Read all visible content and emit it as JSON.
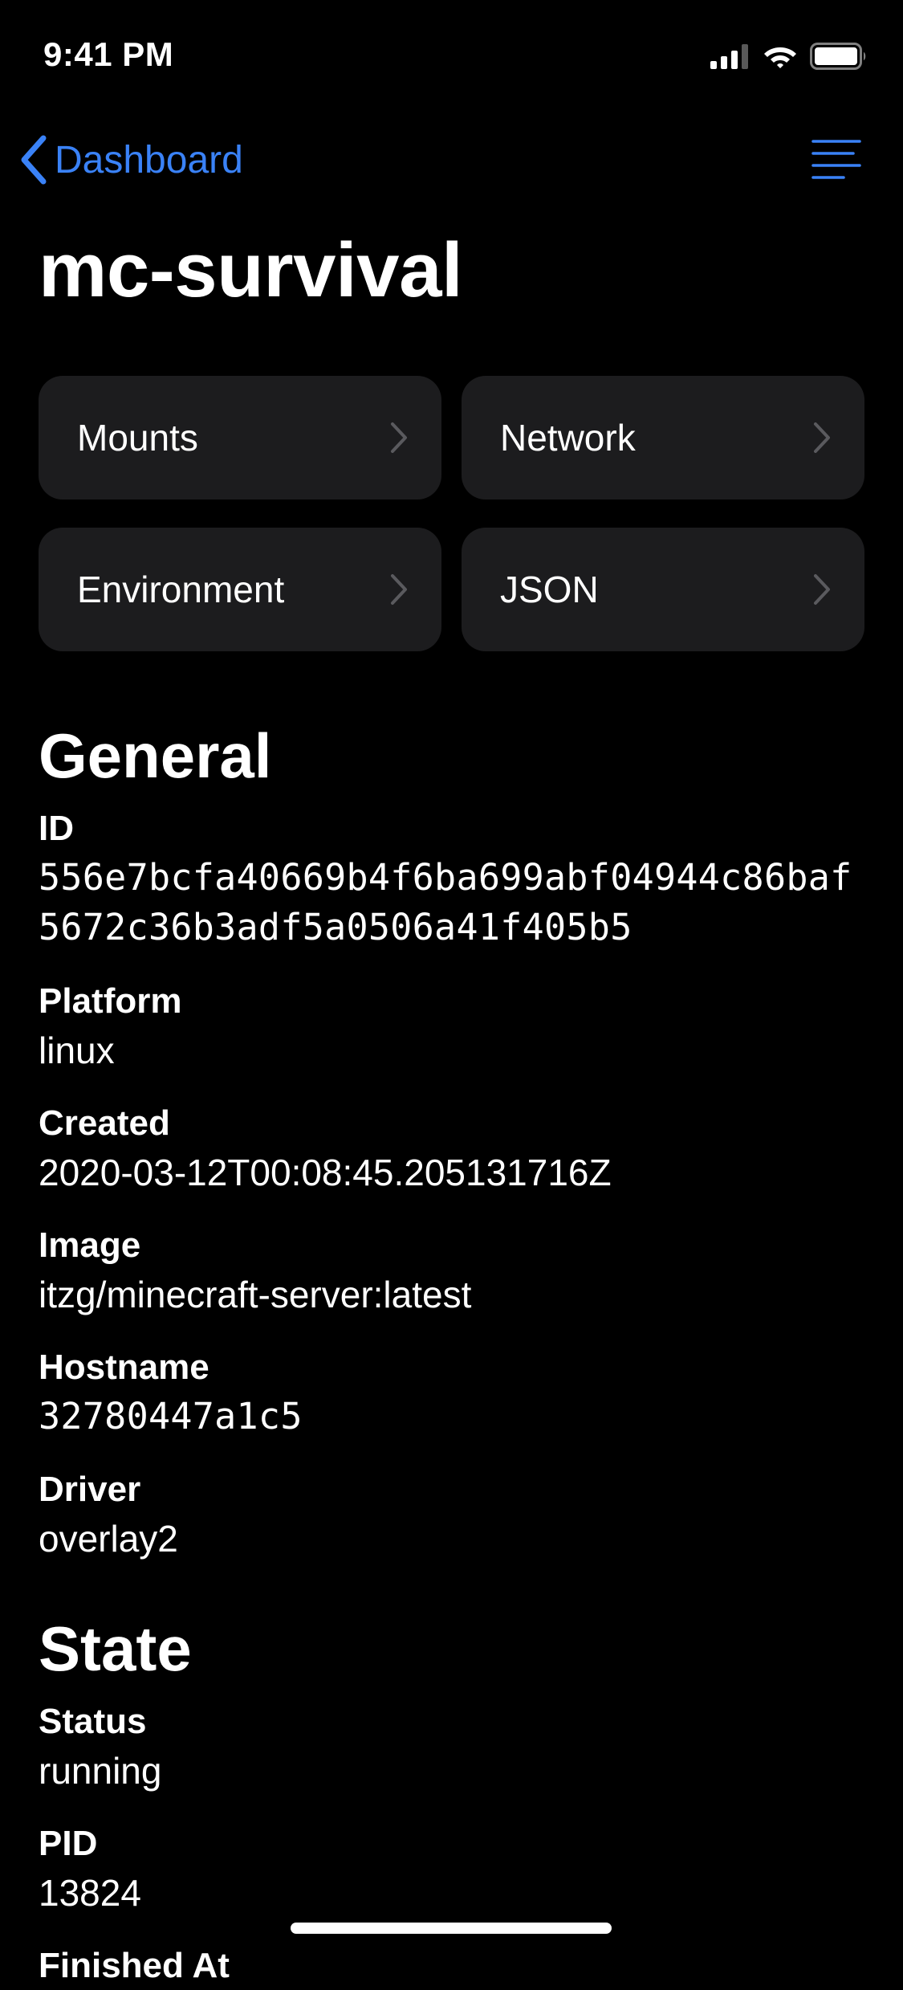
{
  "status_bar": {
    "time": "9:41 PM",
    "icons": [
      "cellular-signal-icon",
      "wifi-icon",
      "battery-icon"
    ]
  },
  "nav": {
    "back_label": "Dashboard",
    "menu_icon": "menu-lines-icon"
  },
  "title": "mc-survival",
  "tiles": [
    {
      "label": "Mounts"
    },
    {
      "label": "Network"
    },
    {
      "label": "Environment"
    },
    {
      "label": "JSON"
    }
  ],
  "sections": {
    "general": {
      "heading": "General",
      "fields": [
        {
          "label": "ID",
          "value": "556e7bcfa40669b4f6ba699abf04944c86baf5672c36b3adf5a0506a41f405b5"
        },
        {
          "label": "Platform",
          "value": "linux"
        },
        {
          "label": "Created",
          "value": "2020-03-12T00:08:45.205131716Z"
        },
        {
          "label": "Image",
          "value": "itzg/minecraft-server:latest"
        },
        {
          "label": "Hostname",
          "value": "32780447a1c5"
        },
        {
          "label": "Driver",
          "value": "overlay2"
        }
      ]
    },
    "state": {
      "heading": "State",
      "fields": [
        {
          "label": "Status",
          "value": "running"
        },
        {
          "label": "PID",
          "value": "13824"
        },
        {
          "label": "Finished At",
          "value": ""
        }
      ]
    }
  },
  "colors": {
    "accent": "#3a82f7",
    "background": "#000000",
    "tile": "#1c1c1e",
    "chevron": "#5a5a5e"
  }
}
